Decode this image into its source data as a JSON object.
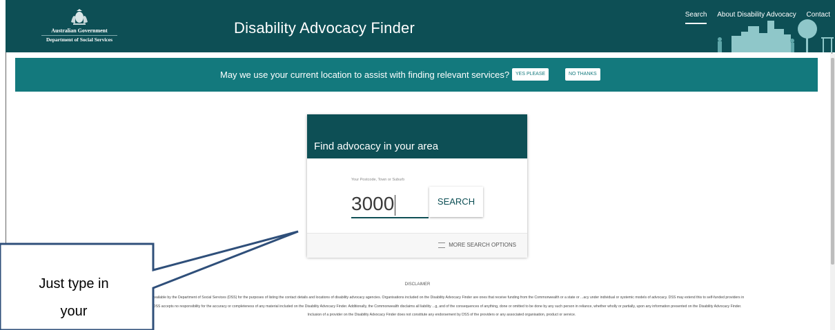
{
  "header": {
    "logo_line1": "Australian Government",
    "logo_line2": "Department of Social Services",
    "title": "Disability Advocacy Finder",
    "nav": [
      "Search",
      "About Disability Advocacy",
      "Contact"
    ]
  },
  "banner": {
    "text": "May we use your current location to assist with finding relevant services?",
    "yes_label": "YES PLEASE",
    "no_label": "NO THANKS"
  },
  "search_card": {
    "title": "Find advocacy in your area",
    "field_label": "Your Postcode, Town or Suburb",
    "field_value": "3000",
    "search_label": "SEARCH",
    "more_options_label": "MORE SEARCH OPTIONS"
  },
  "disclaimer": {
    "title": "DISCLAIMER",
    "text": "...made available by the Department of Social Services (DSS) for the purposes of listing the contact details and locations of disability advocacy agencies. Organisations included on the Disability Advocacy Finder are ones that receive funding from the Commonwealth or a state or ...acy under individual or systemic models of advocacy. DSS may extend this to self-funded providers in future. DSS accepts no responsibility for the accuracy or completeness of any material included on the Disability Advocacy Finder. Additionally, the Commonwealth disclaims all liability ...g, and of the consequences of anything, done or omitted to be done by any such person in reliance, whether wholly or partially, upon any information presented on the Disability Advocacy Finder. Inclusion of a provider on the Disability Advocacy Finder does not constitute any endorsement by DSS of the providers or any associated organisation, product or service."
  },
  "callout": {
    "line1": "Just type in",
    "line2": "your"
  },
  "colors": {
    "header": "#0d4f55",
    "banner": "#13797d"
  }
}
